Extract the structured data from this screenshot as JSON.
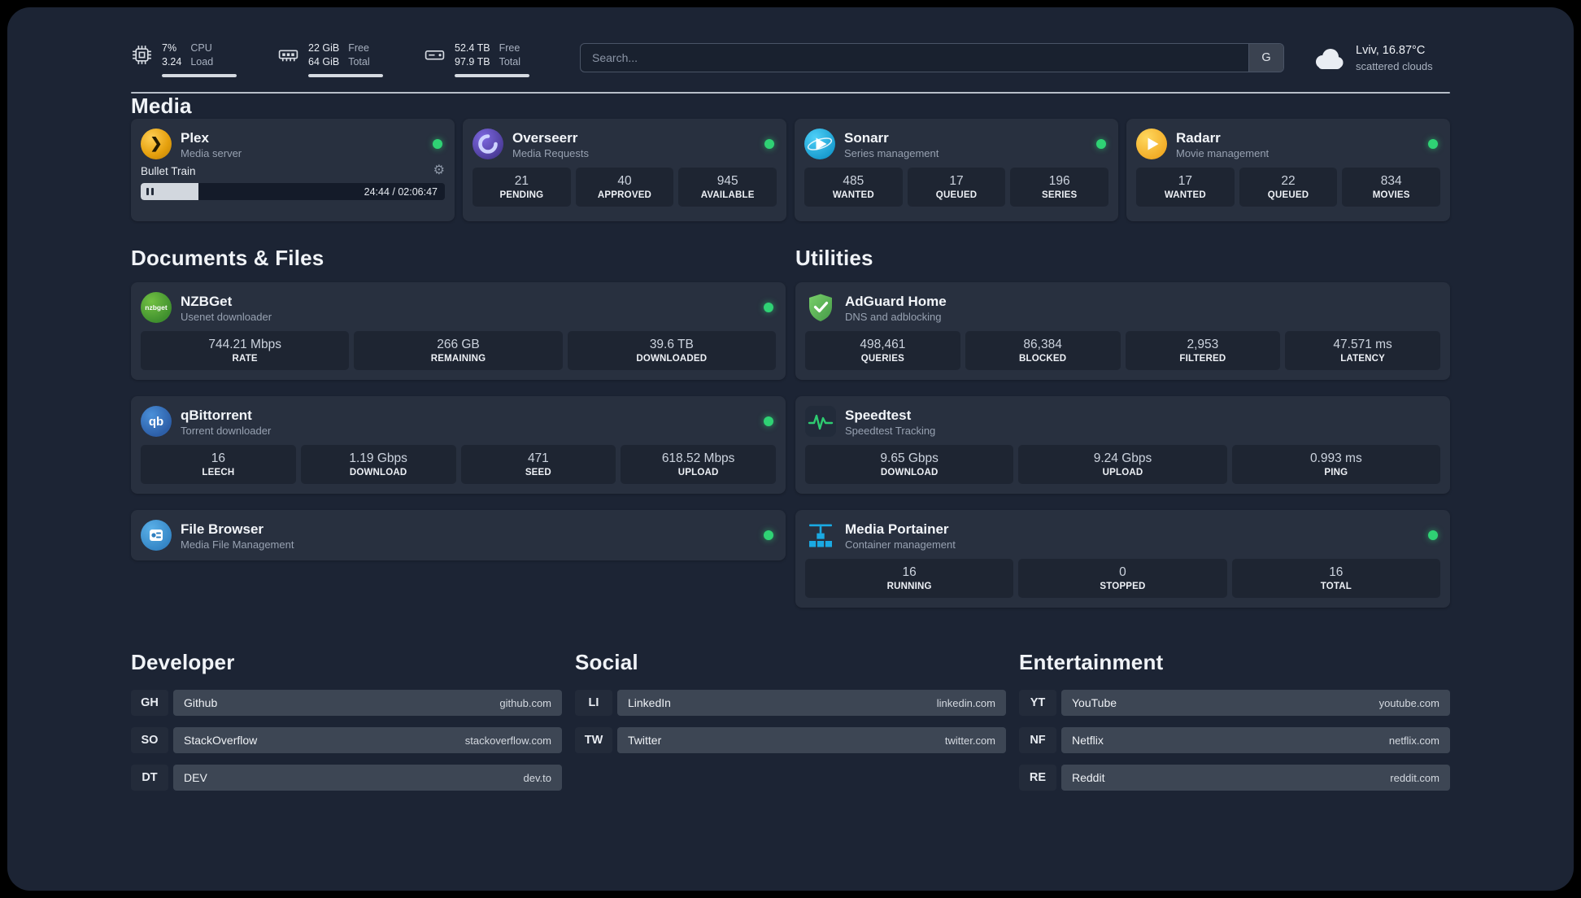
{
  "topbar": {
    "cpu": {
      "percent": "7%",
      "value": "3.24",
      "label_line1": "CPU",
      "label_line2": "Load",
      "bar_pct": 100
    },
    "memory": {
      "free": "22 GiB",
      "total": "64 GiB",
      "label_line1": "Free",
      "label_line2": "Total",
      "bar_pct": 100
    },
    "disk": {
      "free": "52.4 TB",
      "total": "97.9 TB",
      "label_line1": "Free",
      "label_line2": "Total",
      "bar_pct": 100
    },
    "search": {
      "placeholder": "Search...",
      "button_label": "G"
    },
    "weather": {
      "location": "Lviv, 16.87°C",
      "condition": "scattered clouds"
    }
  },
  "media": {
    "heading": "Media",
    "cards": [
      {
        "title": "Plex",
        "subtitle": "Media server",
        "player": {
          "track": "Bullet Train",
          "time": "24:44 / 02:06:47",
          "progress_pct": 19
        }
      },
      {
        "title": "Overseerr",
        "subtitle": "Media Requests",
        "stats": [
          {
            "value": "21",
            "label": "PENDING"
          },
          {
            "value": "40",
            "label": "APPROVED"
          },
          {
            "value": "945",
            "label": "AVAILABLE"
          }
        ]
      },
      {
        "title": "Sonarr",
        "subtitle": "Series management",
        "stats": [
          {
            "value": "485",
            "label": "WANTED"
          },
          {
            "value": "17",
            "label": "QUEUED"
          },
          {
            "value": "196",
            "label": "SERIES"
          }
        ]
      },
      {
        "title": "Radarr",
        "subtitle": "Movie management",
        "stats": [
          {
            "value": "17",
            "label": "WANTED"
          },
          {
            "value": "22",
            "label": "QUEUED"
          },
          {
            "value": "834",
            "label": "MOVIES"
          }
        ]
      }
    ]
  },
  "documents": {
    "heading": "Documents & Files",
    "cards": [
      {
        "title": "NZBGet",
        "subtitle": "Usenet downloader",
        "stats": [
          {
            "value": "744.21 Mbps",
            "label": "RATE"
          },
          {
            "value": "266 GB",
            "label": "REMAINING"
          },
          {
            "value": "39.6 TB",
            "label": "DOWNLOADED"
          }
        ]
      },
      {
        "title": "qBittorrent",
        "subtitle": "Torrent downloader",
        "stats": [
          {
            "value": "16",
            "label": "LEECH"
          },
          {
            "value": "1.19 Gbps",
            "label": "DOWNLOAD"
          },
          {
            "value": "471",
            "label": "SEED"
          },
          {
            "value": "618.52 Mbps",
            "label": "UPLOAD"
          }
        ]
      },
      {
        "title": "File Browser",
        "subtitle": "Media File Management"
      }
    ]
  },
  "utilities": {
    "heading": "Utilities",
    "cards": [
      {
        "title": "AdGuard Home",
        "subtitle": "DNS and adblocking",
        "stats": [
          {
            "value": "498,461",
            "label": "QUERIES"
          },
          {
            "value": "86,384",
            "label": "BLOCKED"
          },
          {
            "value": "2,953",
            "label": "FILTERED"
          },
          {
            "value": "47.571 ms",
            "label": "LATENCY"
          }
        ]
      },
      {
        "title": "Speedtest",
        "subtitle": "Speedtest Tracking",
        "stats": [
          {
            "value": "9.65 Gbps",
            "label": "DOWNLOAD"
          },
          {
            "value": "9.24 Gbps",
            "label": "UPLOAD"
          },
          {
            "value": "0.993 ms",
            "label": "PING"
          }
        ]
      },
      {
        "title": "Media Portainer",
        "subtitle": "Container management",
        "stats": [
          {
            "value": "16",
            "label": "RUNNING"
          },
          {
            "value": "0",
            "label": "STOPPED"
          },
          {
            "value": "16",
            "label": "TOTAL"
          }
        ]
      }
    ]
  },
  "bookmarks": [
    {
      "heading": "Developer",
      "items": [
        {
          "abbr": "GH",
          "name": "Github",
          "url": "github.com"
        },
        {
          "abbr": "SO",
          "name": "StackOverflow",
          "url": "stackoverflow.com"
        },
        {
          "abbr": "DT",
          "name": "DEV",
          "url": "dev.to"
        }
      ]
    },
    {
      "heading": "Social",
      "items": [
        {
          "abbr": "LI",
          "name": "LinkedIn",
          "url": "linkedin.com"
        },
        {
          "abbr": "TW",
          "name": "Twitter",
          "url": "twitter.com"
        }
      ]
    },
    {
      "heading": "Entertainment",
      "items": [
        {
          "abbr": "YT",
          "name": "YouTube",
          "url": "youtube.com"
        },
        {
          "abbr": "NF",
          "name": "Netflix",
          "url": "netflix.com"
        },
        {
          "abbr": "RE",
          "name": "Reddit",
          "url": "reddit.com"
        }
      ]
    }
  ],
  "icons": {
    "plex_glyph": "❯",
    "nzbget_text": "nzbget",
    "qbittorrent_text": "qb",
    "gear_glyph": "⚙"
  },
  "colors": {
    "status_green": "#2fd274",
    "accent_blue": "#1aa9e2"
  }
}
